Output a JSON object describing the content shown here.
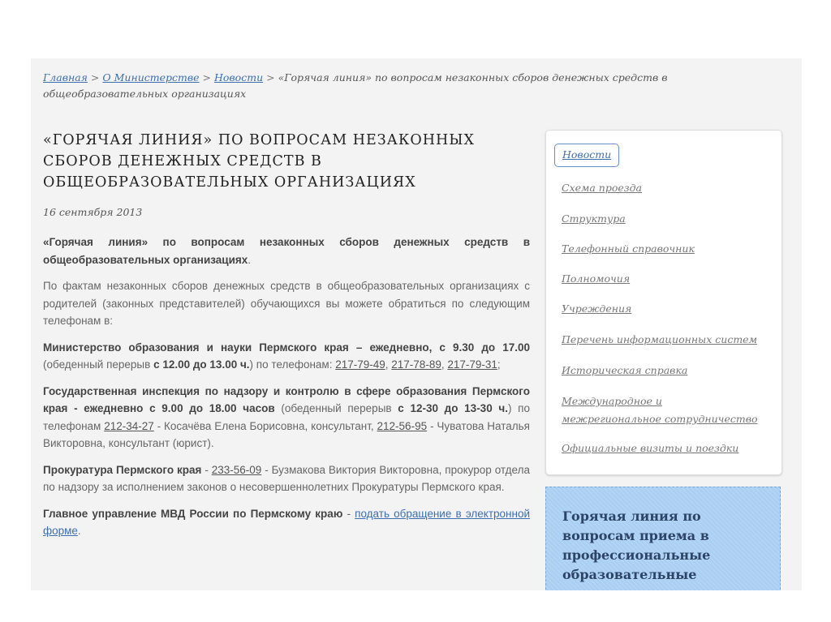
{
  "breadcrumb": {
    "items": [
      {
        "label": "Главная"
      },
      {
        "label": "О Министерстве"
      },
      {
        "label": "Новости"
      }
    ],
    "separator": ">",
    "current": "«Горячая линия» по вопросам незаконных сборов денежных средств в общеобразовательных организациях"
  },
  "article": {
    "title": "«ГОРЯЧАЯ ЛИНИЯ» ПО ВОПРОСАМ НЕЗАКОННЫХ СБОРОВ ДЕНЕЖНЫХ СРЕДСТВ В ОБЩЕОБРАЗОВАТЕЛЬНЫХ ОРГАНИЗАЦИЯХ",
    "date": "16 сентября 2013",
    "paragraphs": [
      [
        {
          "t": "b",
          "text": "«Горячая линия» по вопросам незаконных сборов денежных средств в общеобразовательных организациях"
        },
        {
          "t": "n",
          "text": "."
        }
      ],
      [
        {
          "t": "n",
          "text": "По фактам незаконных сборов денежных средств в общеобразовательных организациях с родителей (законных представителей) обучающихся вы можете обратиться по следующим телефонам в:"
        }
      ],
      [
        {
          "t": "b",
          "text": "Министерство образования и науки Пермского края – ежедневно, с 9.30 до 17.00"
        },
        {
          "t": "n",
          "text": " (обеденный перерыв "
        },
        {
          "t": "b",
          "text": "с 12.00 до 13.00 ч."
        },
        {
          "t": "n",
          "text": ") по телефонам: "
        },
        {
          "t": "tel",
          "text": "217-79-49"
        },
        {
          "t": "n",
          "text": ", "
        },
        {
          "t": "tel",
          "text": "217-78-89"
        },
        {
          "t": "n",
          "text": ", "
        },
        {
          "t": "tel",
          "text": "217-79-31"
        },
        {
          "t": "n",
          "text": ";"
        }
      ],
      [
        {
          "t": "b",
          "text": "Государственная инспекция по надзору и контролю в сфере образования Пермского края - ежедневно с 9.00 до 18.00 часов"
        },
        {
          "t": "n",
          "text": " (обеденный перерыв "
        },
        {
          "t": "b",
          "text": "с 12-30 до 13-30 ч."
        },
        {
          "t": "n",
          "text": ") по телефонам "
        },
        {
          "t": "tel",
          "text": "212-34-27"
        },
        {
          "t": "n",
          "text": " - Косачёва Елена Борисовна, консультант, "
        },
        {
          "t": "tel",
          "text": "212-56-95"
        },
        {
          "t": "n",
          "text": " - Чуватова Наталья Викторовна, консультант (юрист)."
        }
      ],
      [
        {
          "t": "b",
          "text": "Прокуратура Пермского края"
        },
        {
          "t": "n",
          "text": " - "
        },
        {
          "t": "tel",
          "text": "233-56-09"
        },
        {
          "t": "n",
          "text": " - Бузмакова Виктория Викторовна, прокурор отдела по надзору за исполнением законов о несовершеннолетних Прокуратуры Пермского края."
        }
      ],
      [
        {
          "t": "b",
          "text": "Главное управление МВД России по Пермскому краю"
        },
        {
          "t": "n",
          "text": " - "
        },
        {
          "t": "link",
          "text": "подать обращение в электронной форме"
        },
        {
          "t": "n",
          "text": "."
        }
      ]
    ]
  },
  "sidebar": {
    "items": [
      {
        "label": "Новости",
        "active": true
      },
      {
        "label": "Схема проезда"
      },
      {
        "label": "Структура"
      },
      {
        "label": "Телефонный справочник"
      },
      {
        "label": "Полномочия"
      },
      {
        "label": "Учреждения"
      },
      {
        "label": "Перечень информационных систем"
      },
      {
        "label": "Историческая справка"
      },
      {
        "label": "Международное и межрегиональное сотрудничество"
      },
      {
        "label": "Официальные визиты и поездки"
      }
    ]
  },
  "hotline": {
    "text": "Горячая линия по вопросам приема в профессиональные образовательные"
  },
  "colors": {
    "link": "#3d6fb0",
    "panel": "#f3f3f3",
    "hotline": "#b3d5f5"
  }
}
